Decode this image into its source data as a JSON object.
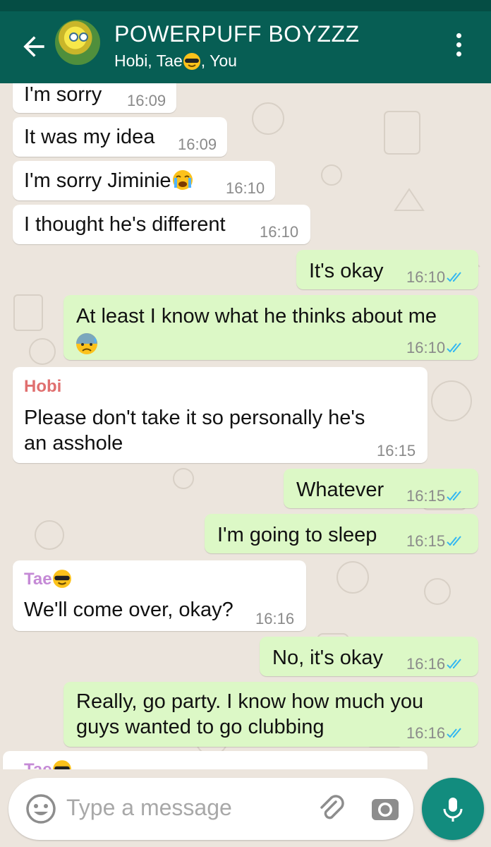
{
  "header": {
    "title": "POWERPUFF BOYZZZ",
    "subtitle_prefix": "Hobi, Tae",
    "subtitle_suffix": ", You",
    "back_icon": "arrow-back-icon",
    "menu_icon": "more-vert-icon"
  },
  "messages": [
    {
      "dir": "in",
      "text": "I'm sorry",
      "time": "16:09"
    },
    {
      "dir": "in",
      "text": "It was my idea",
      "time": "16:09"
    },
    {
      "dir": "in",
      "text": "I'm sorry Jiminie",
      "emoji": "loudly-crying-face",
      "time": "16:10"
    },
    {
      "dir": "in",
      "text": "I thought he's different",
      "time": "16:10"
    },
    {
      "dir": "out",
      "text": "It's okay",
      "time": "16:10",
      "status": "read"
    },
    {
      "dir": "out",
      "text": "At least I know what he thinks about me",
      "emoji": "anxious-face-with-sweat",
      "time": "16:10",
      "status": "read"
    },
    {
      "dir": "in",
      "sender": "Hobi",
      "text_line1": "Please don't take it so personally he's",
      "text_line2": "an asshole",
      "time": "16:15"
    },
    {
      "dir": "out",
      "text": "Whatever",
      "time": "16:15",
      "status": "read"
    },
    {
      "dir": "out",
      "text": "I'm going to sleep",
      "time": "16:15",
      "status": "read"
    },
    {
      "dir": "in",
      "sender": "Tae",
      "sender_emoji": "smiling-face-with-sunglasses",
      "text": "We'll come over, okay?",
      "time": "16:16"
    },
    {
      "dir": "out",
      "text": "No, it's okay",
      "time": "16:16",
      "status": "read"
    },
    {
      "dir": "out",
      "text_line1": "Really, go party. I know how much you",
      "text_line2": "guys wanted to go clubbing",
      "time": "16:16",
      "status": "read"
    },
    {
      "dir": "in",
      "sender": "Tae",
      "partial": true
    }
  ],
  "composer": {
    "placeholder": "Type a message",
    "emoji_icon": "emoji-icon",
    "attach_icon": "attach-icon",
    "camera_icon": "camera-icon",
    "mic_icon": "mic-icon"
  },
  "colors": {
    "appbar": "#075e54",
    "chat_background": "#ece5dd",
    "incoming_bubble": "#ffffff",
    "outgoing_bubble": "#dcf8c6",
    "read_ticks": "#34b7f1",
    "hobi_name": "#e06f6f",
    "tae_name": "#c58ad6",
    "send_button": "#128c7e"
  }
}
